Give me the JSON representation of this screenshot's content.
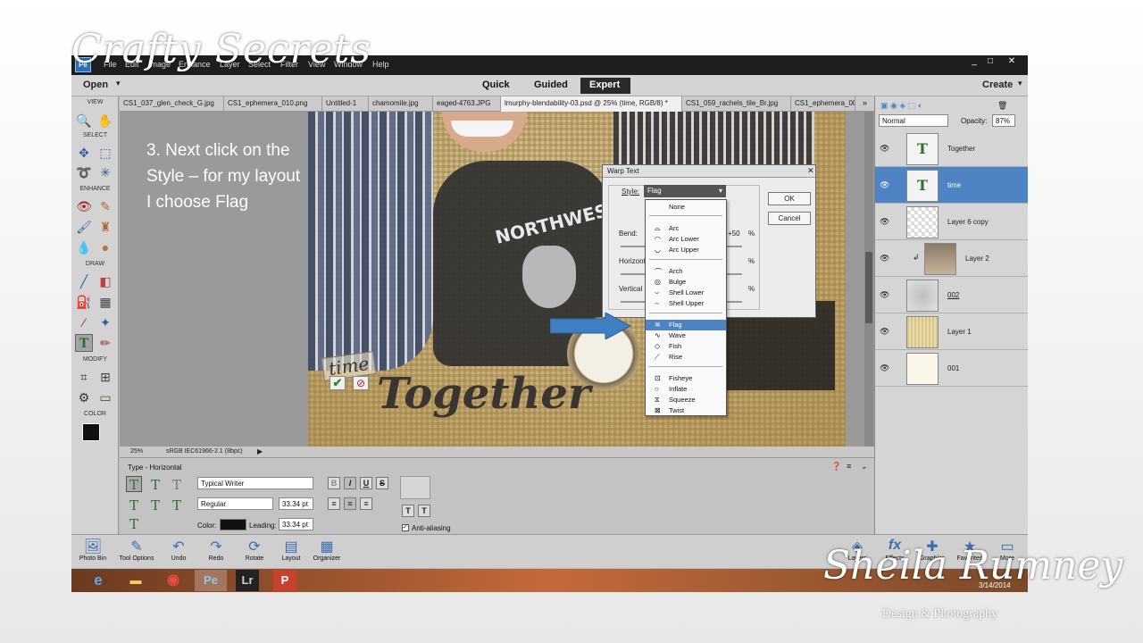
{
  "overlay": {
    "brand_top": "Crafty Secrets",
    "brand_name": "Sheila Rumney",
    "brand_tagline": "Design  & Photography"
  },
  "instruction": "3. Next click on the Style – for my layout I choose Flag",
  "menus": [
    "File",
    "Edit",
    "Image",
    "Enhance",
    "Layer",
    "Select",
    "Filter",
    "View",
    "Window",
    "Help"
  ],
  "window_controls": [
    "_",
    "□",
    "✕"
  ],
  "top_bar": {
    "open_label": "Open",
    "create_label": "Create",
    "modes": [
      "Quick",
      "Guided",
      "Expert"
    ]
  },
  "toolbox": {
    "sections": [
      "VIEW",
      "SELECT",
      "ENHANCE",
      "DRAW",
      "MODIFY",
      "COLOR"
    ]
  },
  "doc_tabs": [
    "CS1_037_glen_check_G.jpg",
    "CS1_ephemera_010.png",
    "Untitled-1",
    "chamomile.jpg",
    "eaged-4763.JPG",
    "lmurphy-blendability-03.psd @ 25% (time, RGB/8) *",
    "CS1_059_rachels_tile_Br.jpg",
    "CS1_ephemera_005"
  ],
  "canvas": {
    "text_together": "Together",
    "text_time": "time",
    "shirt_text": "NORTHWEST"
  },
  "status": {
    "zoom": "25%",
    "profile": "sRGB IEC61966-2.1 (8bpc)"
  },
  "tool_options": {
    "title": "Type - Horizontal",
    "font": "Typical Writer",
    "style": "Regular",
    "size": "33.34 pt",
    "leading": "33.34 pt",
    "color_label": "Color:",
    "leading_label": "Leading:",
    "antialias_label": "Anti-aliasing",
    "format_buttons": [
      "B",
      "I",
      "U",
      "S"
    ]
  },
  "layers_panel": {
    "blend_mode": "Normal",
    "opacity_label": "Opacity:",
    "opacity": "87%",
    "layers": [
      {
        "name": "Together"
      },
      {
        "name": "time"
      },
      {
        "name": "Layer 6 copy"
      },
      {
        "name": "Layer 2"
      },
      {
        "name": "002"
      },
      {
        "name": "Layer 1"
      },
      {
        "name": "001"
      }
    ]
  },
  "warp_dialog": {
    "title": "Warp Text",
    "style_label": "Style:",
    "style_value": "Flag",
    "ok": "OK",
    "cancel": "Cancel",
    "bend_label": "Bend:",
    "bend_value": "+50",
    "horizontal_label": "Horizont",
    "vertical_label": "Vertical D",
    "percent": "%"
  },
  "style_options": [
    "None",
    "Arc",
    "Arc Lower",
    "Arc Upper",
    "Arch",
    "Bulge",
    "Shell Lower",
    "Shell Upper",
    "Flag",
    "Wave",
    "Fish",
    "Rise",
    "Fisheye",
    "Inflate",
    "Squeeze",
    "Twist"
  ],
  "bottom_bar": {
    "left": [
      "Photo Bin",
      "Tool Options",
      "Undo",
      "Redo",
      "Rotate",
      "Layout",
      "Organizer"
    ],
    "right": [
      "Layers",
      "Effects",
      "Graphics",
      "Favorites",
      "More"
    ]
  },
  "taskbar": {
    "date": "3/14/2014"
  },
  "colors": {
    "accent": "#4f84c4",
    "dark": "#1e1e1e",
    "arrow": "#3f7fc4"
  }
}
